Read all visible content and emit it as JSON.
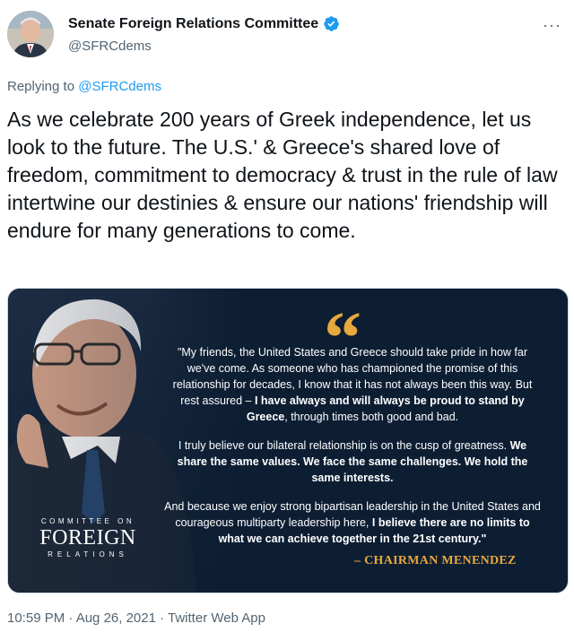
{
  "author": {
    "display_name": "Senate Foreign Relations Committee",
    "handle": "@SFRCdems",
    "verified_icon": "verified-badge-icon",
    "more_icon": "more-horizontal-icon"
  },
  "reply": {
    "prefix": "Replying to",
    "target": "@SFRCdems"
  },
  "tweet": {
    "text": "As we celebrate 200 years of Greek independence, let us look to the future. The U.S.' & Greece's shared love of freedom, commitment to democracy & trust in the rule of law intertwine our destinies & ensure our nations' friendship will endure for many generations to come."
  },
  "media": {
    "quote_mark": "“",
    "paragraph1_plain": "\"My friends, the United States and Greece should take pride in how far we've come. As someone who has championed the promise of this relationship for decades, I know that it has not always been this way. But rest assured –",
    "paragraph1_bold1": "I have always and will always be proud to stand by Greece",
    "paragraph1_end": ", through times both good and bad.",
    "paragraph2_plain": "I truly believe our bilateral relationship is on the cusp of greatness.",
    "paragraph2_bold": "We share the same values. We face the same challenges. We hold the same interests.",
    "paragraph3_plain": "And because we enjoy strong bipartisan leadership in the United States and courageous multiparty leadership here,",
    "paragraph3_bold": "I believe there are no limits to what we can achieve together in the 21st century.\"",
    "attribution": "– CHAIRMAN MENENDEZ",
    "logo_top": "COMMITTEE ON",
    "logo_main": "FOREIGN",
    "logo_bottom": "RELATIONS",
    "accent_color": "#e7a83d",
    "background_color": "#0d1e33"
  },
  "meta": {
    "timestamp": "10:59 PM · Aug 26, 2021 · Twitter Web App"
  }
}
